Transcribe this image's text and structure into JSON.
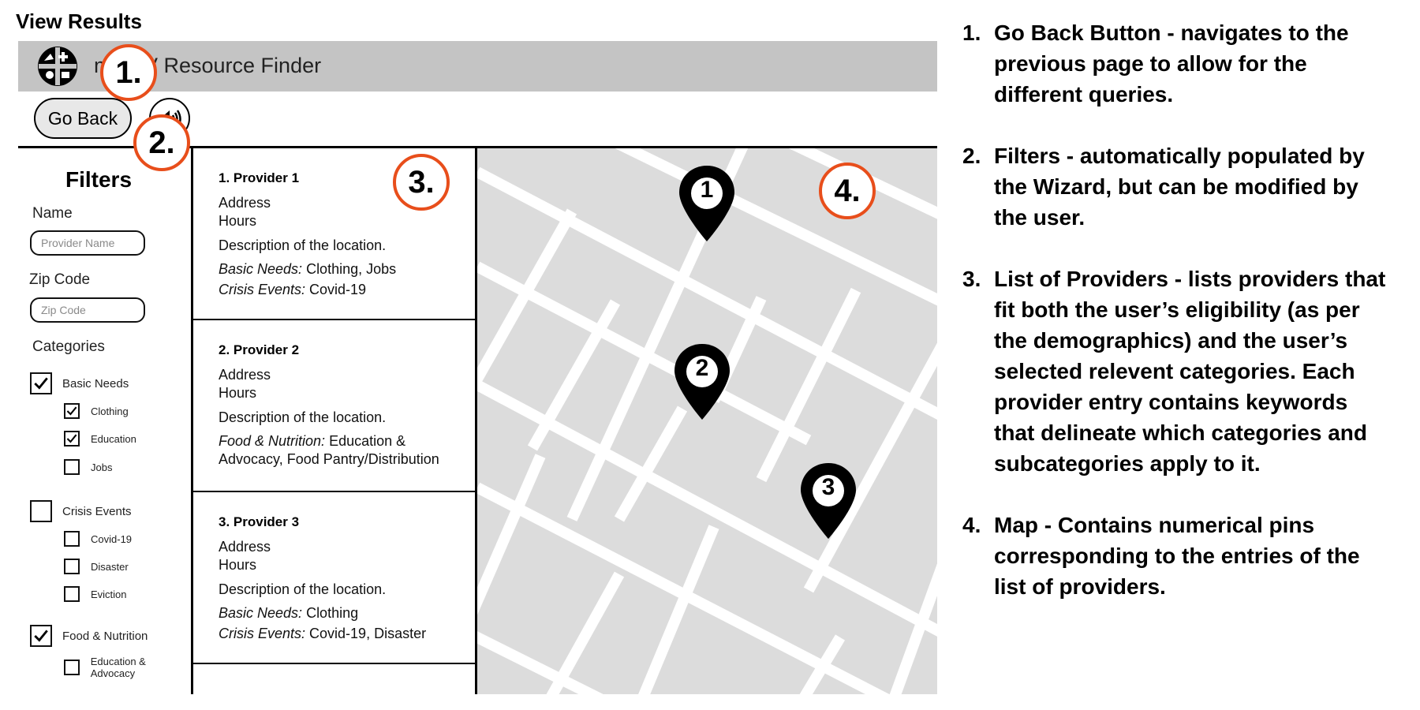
{
  "page_heading": "View Results",
  "app": {
    "title": "myHIV Resource Finder",
    "go_back_label": "Go Back"
  },
  "filters": {
    "title": "Filters",
    "name_label": "Name",
    "name_placeholder": "Provider Name",
    "zip_label": "Zip Code",
    "zip_placeholder": "Zip Code",
    "categories_label": "Categories",
    "groups": [
      {
        "label": "Basic Needs",
        "checked": true,
        "subs": [
          {
            "label": "Clothing",
            "checked": true
          },
          {
            "label": "Education",
            "checked": true
          },
          {
            "label": "Jobs",
            "checked": false
          }
        ]
      },
      {
        "label": "Crisis Events",
        "checked": false,
        "subs": [
          {
            "label": "Covid-19",
            "checked": false
          },
          {
            "label": "Disaster",
            "checked": false
          },
          {
            "label": "Eviction",
            "checked": false
          }
        ]
      },
      {
        "label": "Food & Nutrition",
        "checked": true,
        "subs": [
          {
            "label": "Education & Advocacy",
            "checked": false
          }
        ]
      }
    ]
  },
  "providers": [
    {
      "name": "1. Provider 1",
      "address": "Address",
      "hours": "Hours",
      "description": "Description of the location.",
      "tag1_label": "Basic Needs:",
      "tag1_value": " Clothing, Jobs",
      "tag2_label": "Crisis Events:",
      "tag2_value": " Covid-19"
    },
    {
      "name": "2. Provider 2",
      "address": "Address",
      "hours": "Hours",
      "description": "Description of the location.",
      "tag1_label": "Food & Nutrition:",
      "tag1_value": " Education &",
      "tag2_label": "",
      "tag2_value": "Advocacy, Food Pantry/Distribution"
    },
    {
      "name": "3. Provider 3",
      "address": "Address",
      "hours": "Hours",
      "description": "Description of the location.",
      "tag1_label": "Basic Needs:",
      "tag1_value": " Clothing",
      "tag2_label": "Crisis Events:",
      "tag2_value": " Covid-19, Disaster"
    }
  ],
  "map_pins": [
    "1",
    "2",
    "3"
  ],
  "callouts": [
    "1.",
    "2.",
    "3.",
    "4."
  ],
  "colors": {
    "callout_ring": "#e84e1b",
    "header_bg": "#c4c4c4",
    "map_bg": "#dcdcdc",
    "map_road": "#ffffff"
  },
  "annotations": [
    {
      "num": "1.",
      "text": "Go Back Button - navigates to the previous page to allow for the different queries."
    },
    {
      "num": "2.",
      "text": "Filters - automatically populated by the Wizard, but can be modified by the user."
    },
    {
      "num": "3.",
      "text": "List of Providers - lists providers that fit both the user’s eligibility (as per the demographics) and the user’s selected relevent categories. Each provider entry contains keywords that delineate which categories and subcategories apply to it."
    },
    {
      "num": "4.",
      "text": "Map - Contains numerical pins corresponding to the entries of the list of providers."
    }
  ]
}
